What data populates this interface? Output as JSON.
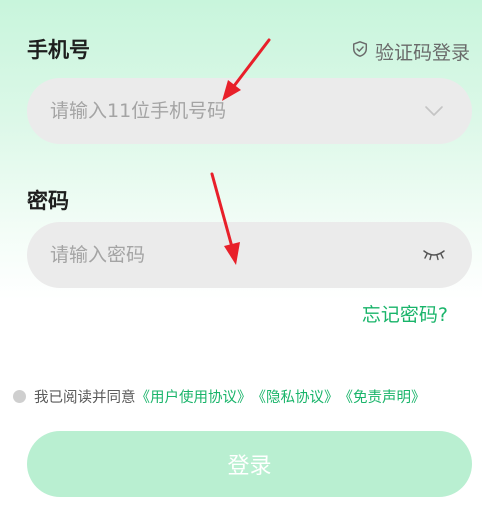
{
  "phone_section": {
    "label": "手机号",
    "verify_login": "验证码登录"
  },
  "phone_input": {
    "placeholder": "请输入11位手机号码",
    "value": ""
  },
  "password_section": {
    "label": "密码"
  },
  "password_input": {
    "placeholder": "请输入密码",
    "value": ""
  },
  "forgot_password": "忘记密码?",
  "agreement": {
    "prefix": "我已阅读并同意",
    "links": [
      "《用户使用协议》",
      "《隐私协议》",
      "《免责声明》"
    ]
  },
  "login_button": "登录",
  "colors": {
    "accent": "#19b46a",
    "button_bg": "#b9efd1",
    "field_bg": "#ebebeb",
    "annotation_arrow": "#e8202a"
  },
  "icons": {
    "verify": "shield-check-icon",
    "phone_dropdown": "chevron-down-icon",
    "password_toggle": "eye-closed-icon"
  }
}
